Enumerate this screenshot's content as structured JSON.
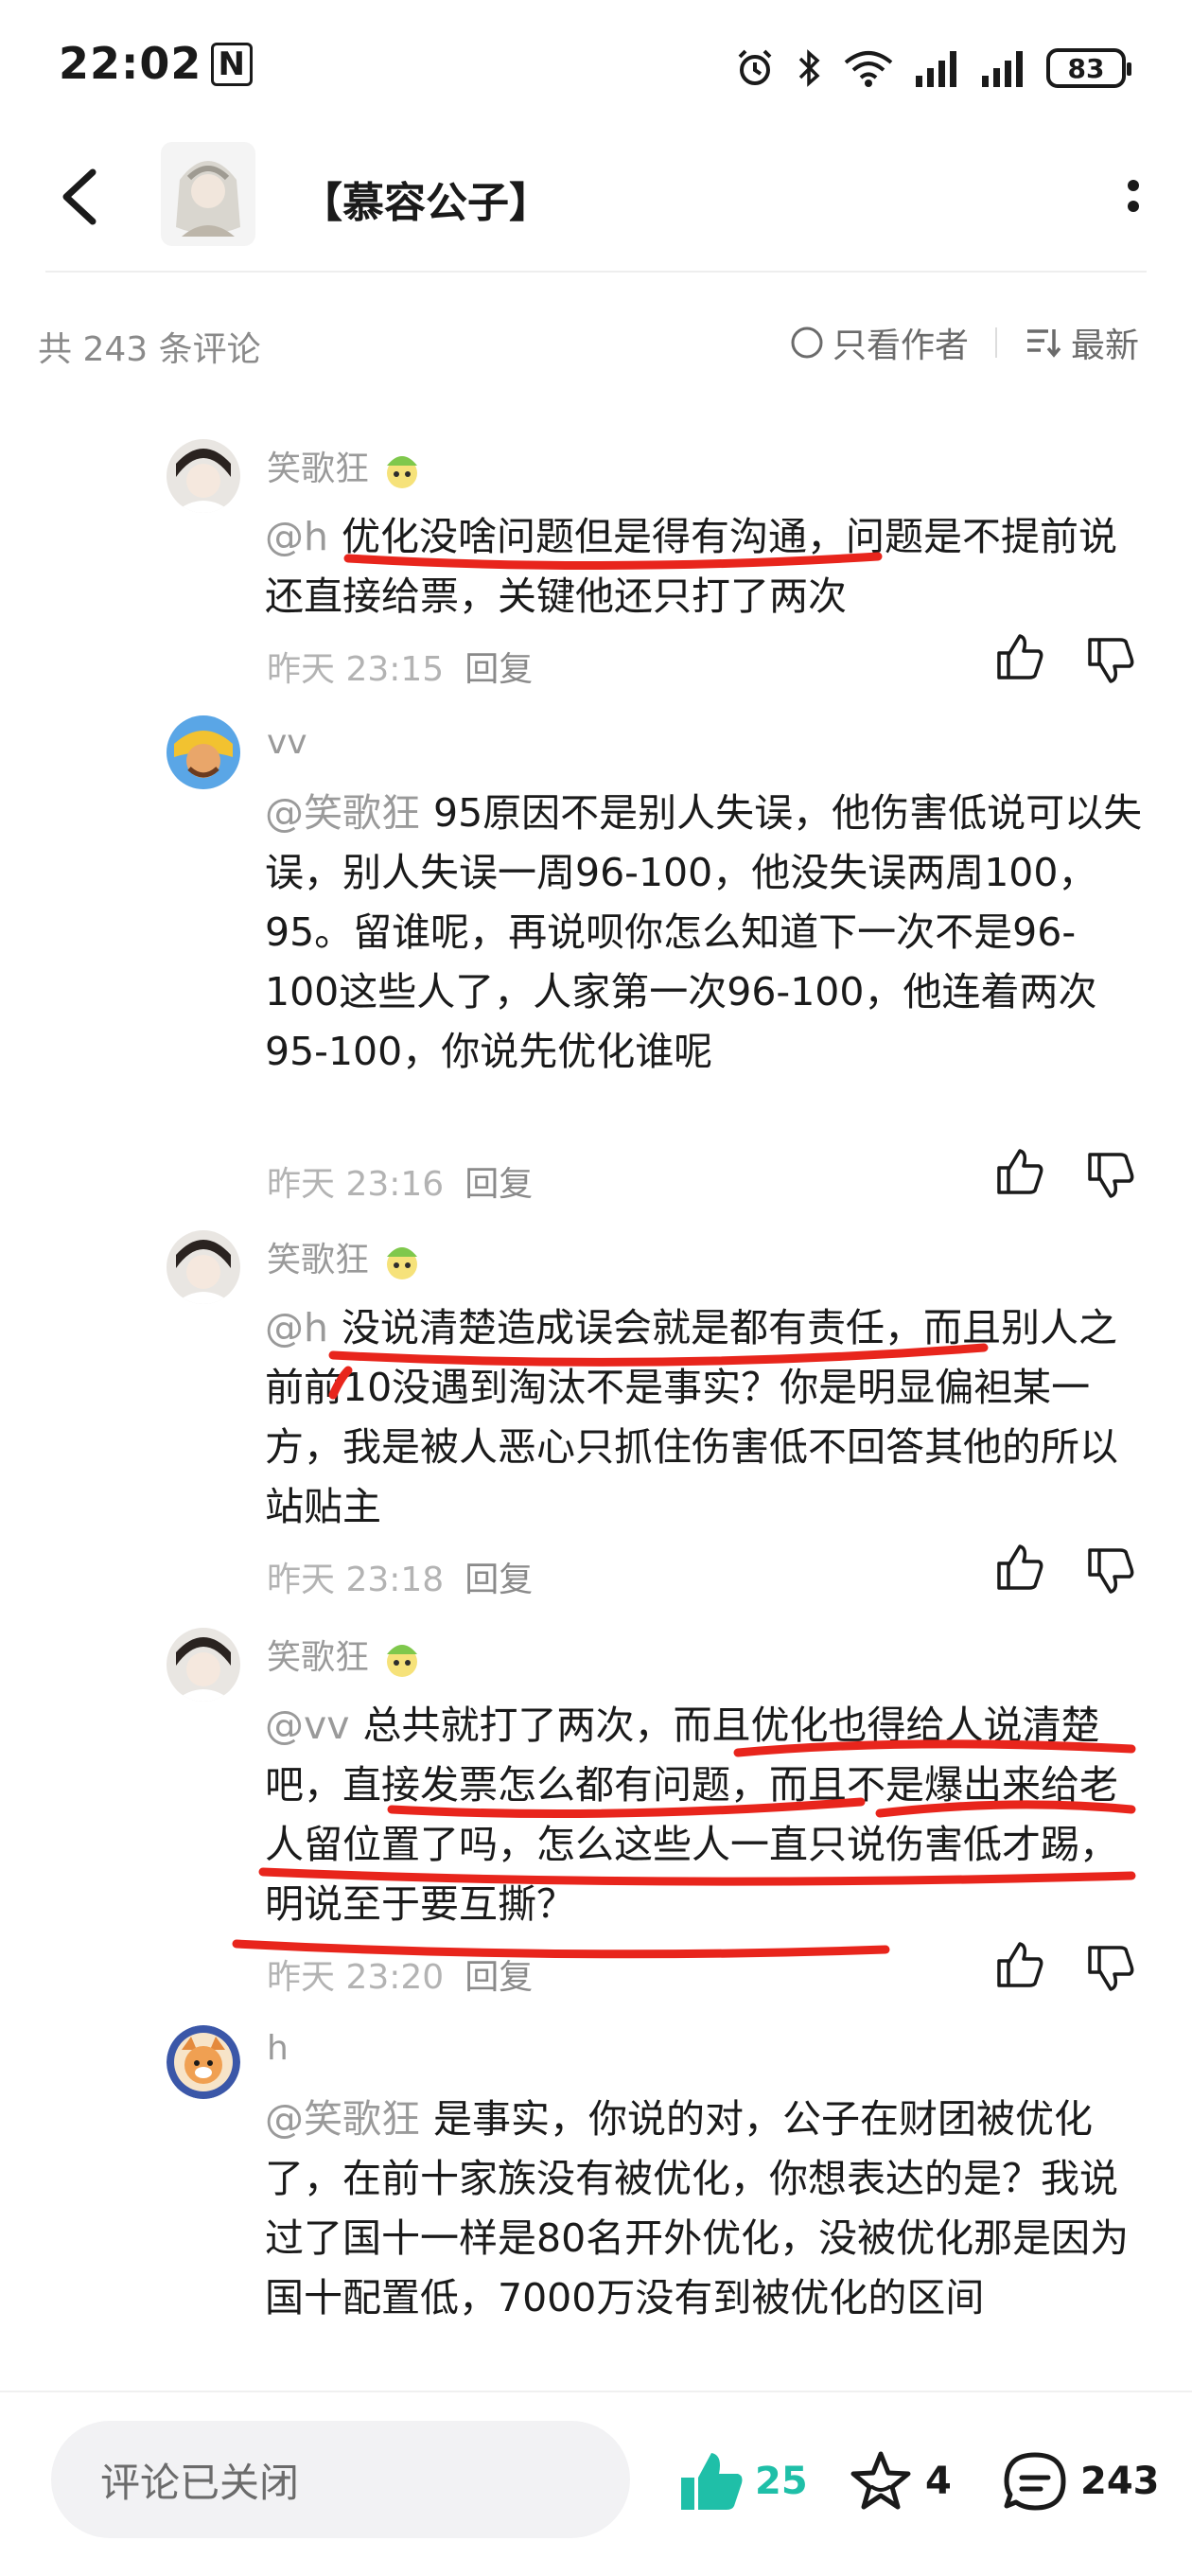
{
  "status_bar": {
    "time": "22:02",
    "nfc_label": "N",
    "battery": "83"
  },
  "header": {
    "title": "【慕容公子】"
  },
  "filter": {
    "count_label": "共 243 条评论",
    "author_only": "只看作者",
    "sort_label": "最新"
  },
  "comments": [
    {
      "user": "笑歌狂",
      "mention": "@h",
      "text": "优化没啥问题但是得有沟通，问题是不提前说还直接给票，关键他还只打了两次",
      "time": "昨天 23:15",
      "reply": "回复"
    },
    {
      "user": "vv",
      "mention": "@笑歌狂",
      "text": "95原因不是别人失误，他伤害低说可以失误，别人失误一周96-100，他没失误两周100，95。留谁呢，再说呗你怎么知道下一次不是96-100这些人了，人家第一次96-100，他连着两次95-100，你说先优化谁呢",
      "time": "昨天 23:16",
      "reply": "回复"
    },
    {
      "user": "笑歌狂",
      "mention": "@h",
      "text": "没说清楚造成误会就是都有责任，而且别人之前前10没遇到淘汰不是事实？你是明显偏袒某一方，我是被人恶心只抓住伤害低不回答其他的所以站贴主",
      "time": "昨天 23:18",
      "reply": "回复"
    },
    {
      "user": "笑歌狂",
      "mention": "@vv",
      "text": "总共就打了两次，而且优化也得给人说清楚吧，直接发票怎么都有问题，而且不是爆出来给老人留位置了吗，怎么这些人一直只说伤害低才踢，明说至于要互撕？",
      "time": "昨天 23:20",
      "reply": "回复"
    },
    {
      "user": "h",
      "mention": "@笑歌狂",
      "text": "是事实，你说的对，公子在财团被优化了，在前十家族没有被优化，你想表达的是？我说过了国十一样是80名开外优化，没被优化那是因为国十配置低，7000万没有到被优化的区间"
    }
  ],
  "bottom_bar": {
    "closed_label": "评论已关闭",
    "like_count": "25",
    "fav_count": "4",
    "comment_count": "243"
  },
  "colors": {
    "accent_teal": "#1fbfa8",
    "marker_red": "#e8251c",
    "muted_text": "#9a9a9a"
  }
}
